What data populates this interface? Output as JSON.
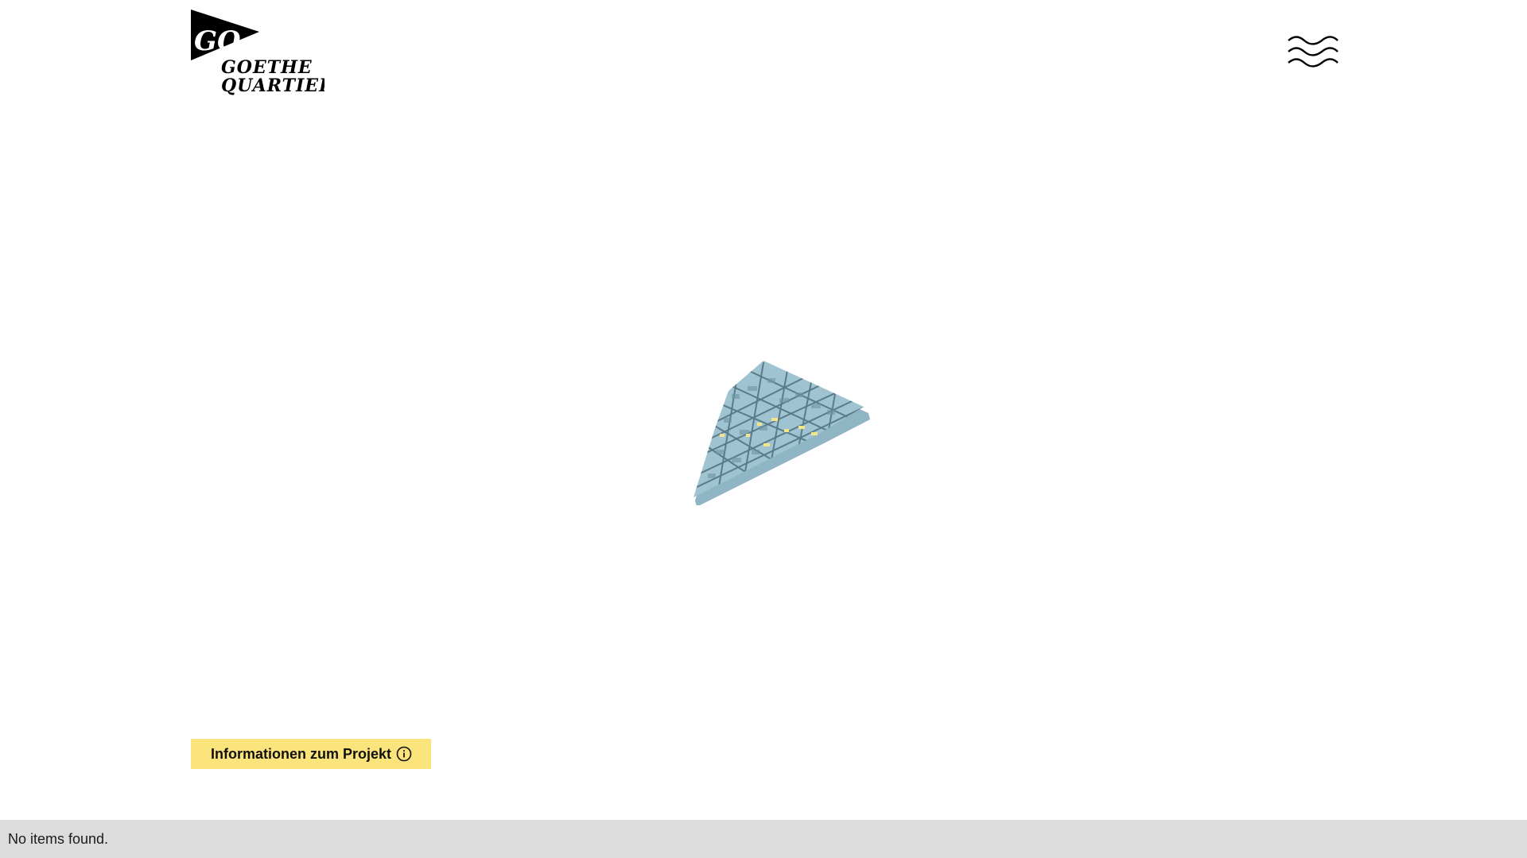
{
  "header": {
    "logo": {
      "pennant_text": "GO",
      "line1": "GOETHE",
      "line2": "QUARTIER"
    },
    "menu_icon": "wavy-hamburger-icon"
  },
  "map": {
    "icon": "3d-district-map",
    "colors": {
      "base": "#8fb5c4",
      "top": "#9fc3d0",
      "street": "#4e6f7c",
      "highlight": "#f2e58a"
    }
  },
  "info_button": {
    "label": "Informationen zum Projekt",
    "icon": "info-circle-icon",
    "color": "#fbe47c"
  },
  "status_bar": {
    "text": "No items found."
  }
}
